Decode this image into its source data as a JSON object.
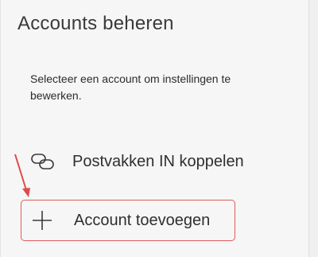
{
  "panel": {
    "title": "Accounts beheren",
    "description": "Selecteer een account om instellingen te bewerken."
  },
  "items": {
    "link_inboxes": {
      "label": "Postvakken IN koppelen",
      "icon": "link-icon"
    },
    "add_account": {
      "label": "Account toevoegen",
      "icon": "plus-icon"
    }
  },
  "annotation": {
    "arrow_color": "#e04a4a",
    "highlight_color": "#e05a5a"
  }
}
